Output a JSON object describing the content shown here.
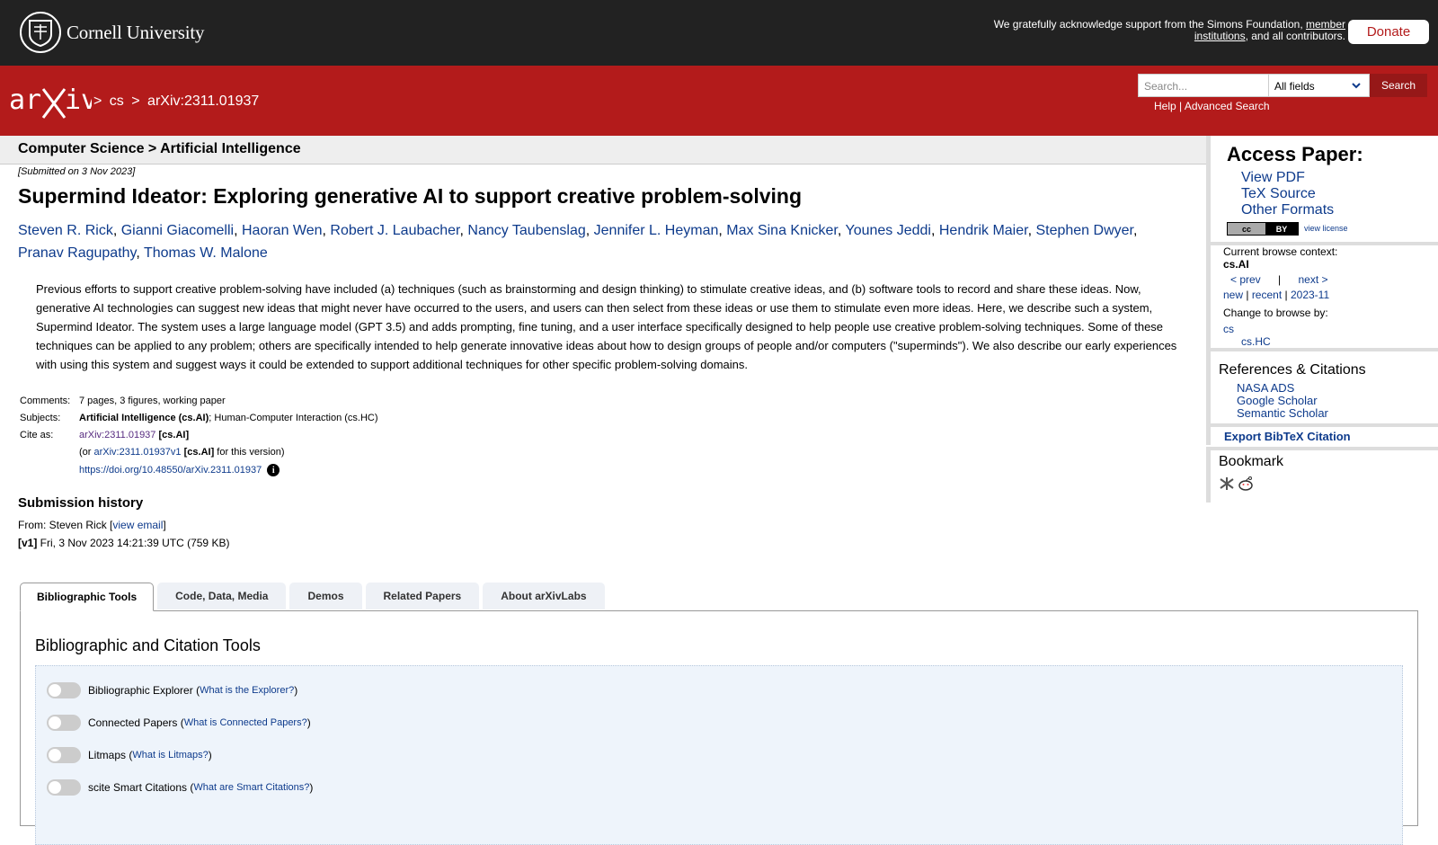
{
  "cornell": {
    "name": "Cornell University",
    "support_prefix": "We gratefully acknowledge support from the Simons Foundation, ",
    "support_link": "member institutions",
    "support_suffix": ", and all contributors.",
    "donate_label": "Donate"
  },
  "header": {
    "breadcrumb_sep1": ">",
    "breadcrumb_cs": "cs",
    "breadcrumb_sep2": ">",
    "breadcrumb_id": "arXiv:2311.01937",
    "search_placeholder": "Search...",
    "search_field": "All fields",
    "search_button": "Search",
    "help_link": "Help",
    "links_sep": "|",
    "advanced_link": "Advanced Search"
  },
  "paper": {
    "category": "Computer Science > Artificial Intelligence",
    "submitted": "[Submitted on 3 Nov 2023]",
    "title": "Supermind Ideator: Exploring generative AI to support creative problem-solving",
    "authors": [
      "Steven R. Rick",
      "Gianni Giacomelli",
      "Haoran Wen",
      "Robert J. Laubacher",
      "Nancy Taubenslag",
      "Jennifer L. Heyman",
      "Max Sina Knicker",
      "Younes Jeddi",
      "Hendrik Maier",
      "Stephen Dwyer",
      "Pranav Ragupathy",
      "Thomas W. Malone"
    ],
    "abstract": "Previous efforts to support creative problem-solving have included (a) techniques (such as brainstorming and design thinking) to stimulate creative ideas, and (b) software tools to record and share these ideas. Now, generative AI technologies can suggest new ideas that might never have occurred to the users, and users can then select from these ideas or use them to stimulate even more ideas. Here, we describe such a system, Supermind Ideator. The system uses a large language model (GPT 3.5) and adds prompting, fine tuning, and a user interface specifically designed to help people use creative problem-solving techniques. Some of these techniques can be applied to any problem; others are specifically intended to help generate innovative ideas about how to design groups of people and/or computers (\"superminds\"). We also describe our early experiences with using this system and suggest ways it could be extended to support additional techniques for other specific problem-solving domains.",
    "comments_label": "Comments:",
    "comments": "7 pages, 3 figures, working paper",
    "subjects_label": "Subjects:",
    "subjects_primary": "Artificial Intelligence (cs.AI)",
    "subjects_rest": "; Human-Computer Interaction (cs.HC)",
    "cite_label": "Cite as:",
    "cite_id": "arXiv:2311.01937",
    "cite_cat": "[cs.AI]",
    "cite_or": "(or ",
    "cite_v1": "arXiv:2311.01937v1",
    "cite_v1_cat": "[cs.AI]",
    "cite_version": " for this version)",
    "doi": "https://doi.org/10.48550/arXiv.2311.01937",
    "info_icon": "i"
  },
  "history": {
    "title": "Submission history",
    "from_prefix": "From: Steven Rick [",
    "view_email": "view email",
    "from_suffix": "]",
    "v1_label": "[v1]",
    "v1_text": " Fri, 3 Nov 2023 14:21:39 UTC (759 KB)"
  },
  "tabs": [
    {
      "label": "Bibliographic Tools"
    },
    {
      "label": "Code, Data, Media"
    },
    {
      "label": "Demos"
    },
    {
      "label": "Related Papers"
    },
    {
      "label": "About arXivLabs"
    }
  ],
  "tools": {
    "title": "Bibliographic and Citation Tools",
    "items": [
      {
        "name": "Bibliographic Explorer",
        "link": "What is the Explorer?"
      },
      {
        "name": "Connected Papers",
        "link": "What is Connected Papers?"
      },
      {
        "name": "Litmaps",
        "link": "What is Litmaps?"
      },
      {
        "name": "scite Smart Citations",
        "link": "What are Smart Citations?"
      }
    ]
  },
  "sidebar": {
    "access_title": "Access Paper:",
    "view_pdf": "View PDF",
    "tex_source": "TeX Source",
    "other_formats": "Other Formats",
    "cc_left": "cc",
    "cc_right": "BY",
    "view_license": "view license",
    "browse_context_label": "Current browse context:",
    "browse_context": "cs.AI",
    "prev": "< prev",
    "nav_sep": "|",
    "next": "next >",
    "new": "new",
    "recent": "recent",
    "month": "2023-11",
    "change_browse": "Change to browse by:",
    "browse_cs": "cs",
    "browse_cshc": "cs.HC",
    "refs_title": "References & Citations",
    "nasa": "NASA ADS",
    "google": "Google Scholar",
    "semantic": "Semantic Scholar",
    "bibtex": "Export BibTeX Citation",
    "bookmark": "Bookmark"
  }
}
